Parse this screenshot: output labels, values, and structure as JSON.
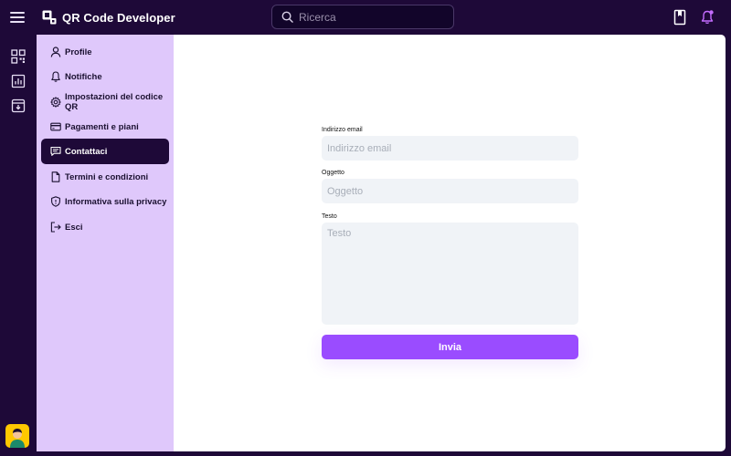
{
  "app": {
    "name": "QR Code Developer",
    "colors": {
      "accent": "#9a4cff",
      "dark": "#1e0938",
      "sidebar": "#dfc8fb"
    }
  },
  "topbar": {
    "menu_icon": "hamburger-menu-icon",
    "search": {
      "placeholder": "Ricerca",
      "value": ""
    },
    "icons": [
      "bookmark-icon",
      "notification-bell-icon"
    ]
  },
  "rail": {
    "icons": [
      "qr-grid-icon",
      "analytics-chart-icon",
      "archive-box-icon"
    ],
    "avatar": "user-avatar"
  },
  "sidebar": {
    "items": [
      {
        "label": "Profile",
        "icon": "user-icon",
        "active": false
      },
      {
        "label": "Notifiche",
        "icon": "bell-icon",
        "active": false
      },
      {
        "label": "Impostazioni del codice QR",
        "icon": "gear-icon",
        "active": false
      },
      {
        "label": "Pagamenti e piani",
        "icon": "credit-card-icon",
        "active": false
      },
      {
        "label": "Contattaci",
        "icon": "chat-icon",
        "active": true
      },
      {
        "label": "Termini e condizioni",
        "icon": "document-icon",
        "active": false
      },
      {
        "label": "Informativa sulla privacy",
        "icon": "shield-icon",
        "active": false
      },
      {
        "label": "Esci",
        "icon": "logout-icon",
        "active": false
      }
    ]
  },
  "form": {
    "email": {
      "label": "Indirizzo email",
      "placeholder": "Indirizzo email",
      "value": ""
    },
    "subject": {
      "label": "Oggetto",
      "placeholder": "Oggetto",
      "value": ""
    },
    "message": {
      "label": "Testo",
      "placeholder": "Testo",
      "value": ""
    },
    "submit_label": "Invia"
  }
}
